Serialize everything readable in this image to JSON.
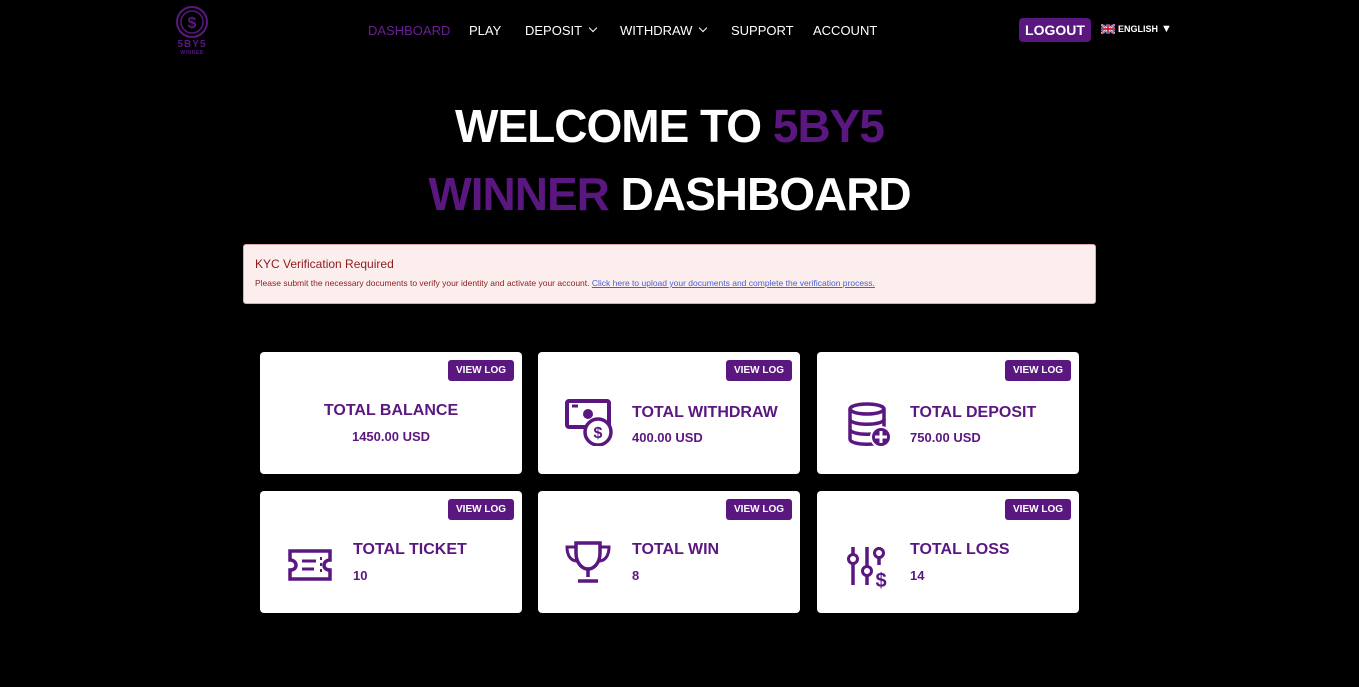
{
  "brand": {
    "logo_text": "5BY5",
    "logo_sub": "WINNER"
  },
  "nav": {
    "items": [
      {
        "label": "DASHBOARD"
      },
      {
        "label": "PLAY"
      },
      {
        "label": "DEPOSIT"
      },
      {
        "label": "WITHDRAW"
      },
      {
        "label": "SUPPORT"
      },
      {
        "label": "ACCOUNT"
      }
    ]
  },
  "header": {
    "logout_label": "LOGOUT",
    "language": "ENGLISH"
  },
  "hero": {
    "line1_white": "WELCOME TO",
    "line1_purple": "5BY5",
    "line2_purple": "WINNER",
    "line2_white": "DASHBOARD"
  },
  "alert": {
    "title": "KYC Verification Required",
    "body": "Please submit the necessary documents to verify your identity and activate your account.",
    "link": "Click here to upload your documents and complete the verification process."
  },
  "cards": [
    {
      "label": "TOTAL BALANCE",
      "value": "1450.00 USD",
      "button": "VIEW LOG",
      "icon": "none"
    },
    {
      "label": "TOTAL WITHDRAW",
      "value": "400.00 USD",
      "button": "VIEW LOG",
      "icon": "cash-dollar-icon"
    },
    {
      "label": "TOTAL DEPOSIT",
      "value": "750.00 USD",
      "button": "VIEW LOG",
      "icon": "database-plus-icon"
    },
    {
      "label": "TOTAL TICKET",
      "value": "10",
      "button": "VIEW LOG",
      "icon": "ticket-icon"
    },
    {
      "label": "TOTAL WIN",
      "value": "8",
      "button": "VIEW LOG",
      "icon": "trophy-icon"
    },
    {
      "label": "TOTAL LOSS",
      "value": "14",
      "button": "VIEW LOG",
      "icon": "sliders-dollar-icon"
    }
  ],
  "colors": {
    "accent": "#5b1780",
    "background": "#000000",
    "alert_bg": "#fdeeee",
    "alert_text": "#8b1c1c"
  }
}
